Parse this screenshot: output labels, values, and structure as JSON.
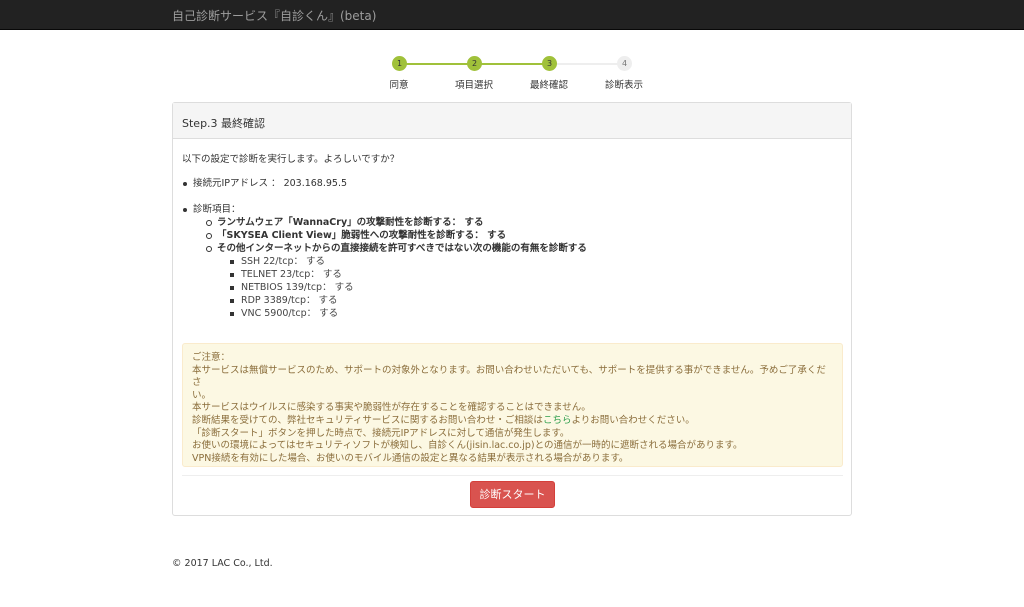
{
  "navbar": {
    "brand": "自己診断サービス『自診くん』(beta)"
  },
  "steps": [
    {
      "number": "1",
      "label": "同意",
      "status": "done"
    },
    {
      "number": "2",
      "label": "項目選択",
      "status": "done"
    },
    {
      "number": "3",
      "label": "最終確認",
      "status": "current"
    },
    {
      "number": "4",
      "label": "診断表示",
      "status": "pending"
    }
  ],
  "colors": {
    "step_active": "#a0c13a",
    "step_pending": "#eeeeee",
    "danger": "#d9534f"
  },
  "panel": {
    "title": "Step.3 最終確認",
    "intro": "以下の設定で診断を実行します。よろしいですか？",
    "ip_line": "接続元IPアドレス ： 203.168.95.5",
    "items_heading": "診断項目：",
    "items": [
      "ランサムウェア「WannaCry」の攻撃耐性を診断する： する",
      "「SKYSEA Client View」脆弱性への攻撃耐性を診断する： する",
      "その他インターネットからの直接接続を許可すべきではない次の機能の有無を診断する"
    ],
    "ports": [
      "SSH 22/tcp： する",
      "TELNET 23/tcp： する",
      "NETBIOS 139/tcp： する",
      "RDP 3389/tcp： する",
      "VNC 5900/tcp： する"
    ]
  },
  "notice": {
    "heading": "ご注意：",
    "line1": "本サービスは無償サービスのため、サポートの対象外となります。お問い合わせいただいても、サポートを提供する事ができません。予めご了承くださ",
    "line1b": "い。",
    "line2": "本サービスはウイルスに感染する事実や脆弱性が存在することを確認することはできません。",
    "line3_pre": "診断結果を受けての、弊社セキュリティサービスに関するお問い合わせ・ご相談は",
    "line3_link": "こちら",
    "line3_post": "よりお問い合わせください。",
    "line4": "「診断スタート」ボタンを押した時点で、接続元IPアドレスに対して通信が発生します。",
    "line5": "お使いの環境によってはセキュリティソフトが検知し、自診くん(jisin.lac.co.jp)との通信が一時的に遮断される場合があります。",
    "line6": "VPN接続を有効にした場合、お使いのモバイル通信の設定と異なる結果が表示される場合があります。"
  },
  "start_button": "診断スタート",
  "footer": "© 2017 LAC Co., Ltd."
}
